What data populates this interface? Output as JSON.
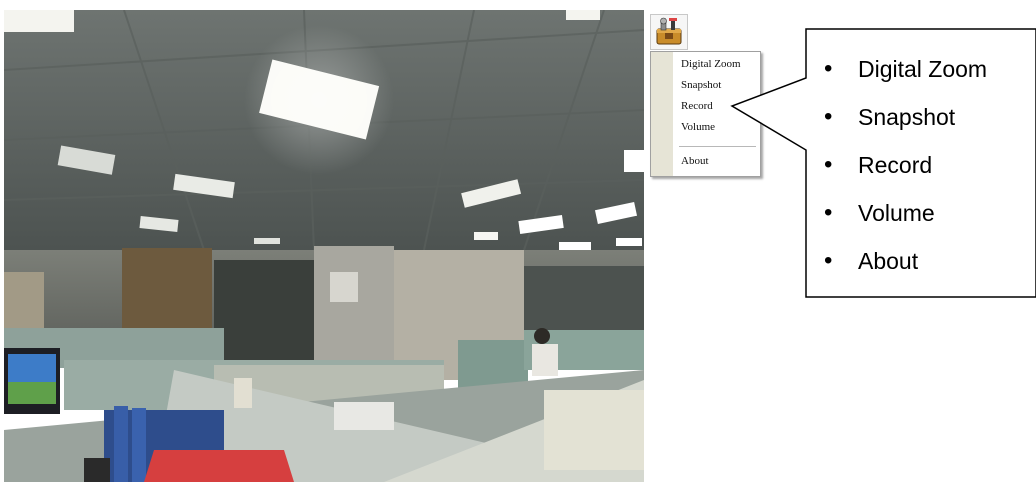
{
  "camera": {
    "description_icon": "camera-feed"
  },
  "toolbar": {
    "icon": "plugin-toolbox-icon"
  },
  "menu": {
    "items": [
      {
        "label": "Digital Zoom"
      },
      {
        "label": "Snapshot"
      },
      {
        "label": "Record"
      },
      {
        "label": "Volume"
      },
      {
        "label": "About"
      }
    ]
  },
  "callout": {
    "items": [
      {
        "label": "Digital Zoom"
      },
      {
        "label": "Snapshot"
      },
      {
        "label": "Record"
      },
      {
        "label": "Volume"
      },
      {
        "label": "About"
      }
    ]
  }
}
